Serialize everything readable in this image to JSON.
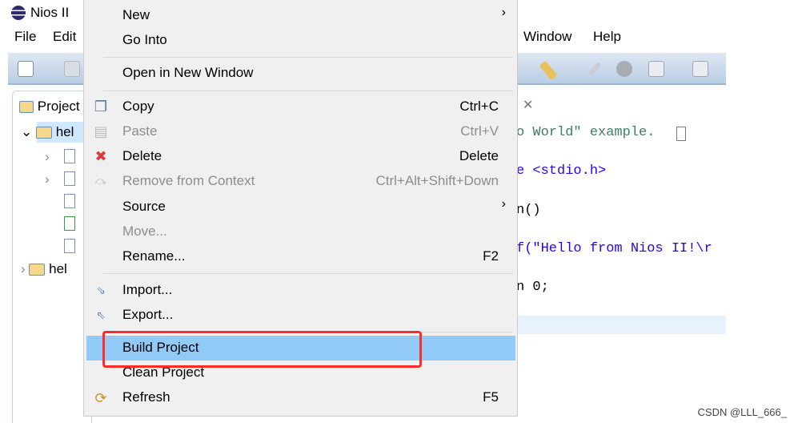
{
  "window": {
    "title": "Nios II"
  },
  "menubar": [
    {
      "label": "File",
      "mnemonic": "F"
    },
    {
      "label": "Edit",
      "mnemonic": "E"
    },
    {
      "label": "Window",
      "mnemonic": "W"
    },
    {
      "label": "Help",
      "mnemonic": "H"
    }
  ],
  "project_explorer": {
    "tab_label": "Project",
    "items": [
      {
        "label": "hel",
        "expanded": true,
        "selected": true
      },
      {
        "label": "hel",
        "expanded": false
      }
    ]
  },
  "editor": {
    "lines": [
      {
        "text": "o World\" example.",
        "color": "#3f7f5f"
      },
      {
        "text": "e <stdio.h>",
        "color": "#2a00ff"
      },
      {
        "text": "n()",
        "color": "#000000"
      },
      {
        "text": "f(\"Hello from Nios II!\\r",
        "color": "#2a00ff"
      },
      {
        "text": "n 0;",
        "color": "#000000"
      }
    ]
  },
  "context_menu": {
    "items": [
      {
        "label": "New",
        "submenu": true
      },
      {
        "label": "Go Into"
      },
      {
        "label": "Open in New Window"
      },
      {
        "label": "Copy",
        "shortcut": "Ctrl+C",
        "icon": "copy-icon"
      },
      {
        "label": "Paste",
        "shortcut": "Ctrl+V",
        "disabled": true,
        "icon": "paste-icon"
      },
      {
        "label": "Delete",
        "shortcut": "Delete",
        "icon": "delete-icon"
      },
      {
        "label": "Remove from Context",
        "shortcut": "Ctrl+Alt+Shift+Down",
        "disabled": true,
        "icon": "remove-context-icon"
      },
      {
        "label": "Source",
        "submenu": true
      },
      {
        "label": "Move...",
        "disabled": true
      },
      {
        "label": "Rename...",
        "shortcut": "F2"
      },
      {
        "label": "Import...",
        "icon": "import-icon"
      },
      {
        "label": "Export...",
        "icon": "export-icon"
      },
      {
        "label": "Build Project",
        "highlighted": true
      },
      {
        "label": "Clean Project"
      },
      {
        "label": "Refresh",
        "shortcut": "F5",
        "icon": "refresh-icon"
      }
    ]
  },
  "colors": {
    "highlight": "#91c9f7",
    "annotation_box": "#ff2a2a"
  },
  "watermark": "CSDN @LLL_666_"
}
